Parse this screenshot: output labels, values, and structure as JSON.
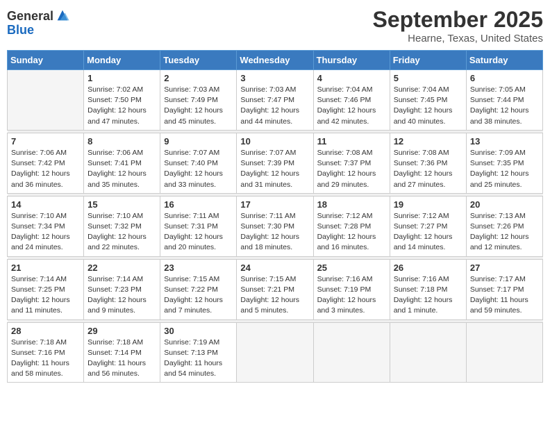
{
  "header": {
    "logo_general": "General",
    "logo_blue": "Blue",
    "month_title": "September 2025",
    "location": "Hearne, Texas, United States"
  },
  "weekdays": [
    "Sunday",
    "Monday",
    "Tuesday",
    "Wednesday",
    "Thursday",
    "Friday",
    "Saturday"
  ],
  "weeks": [
    [
      {
        "day": "",
        "info": ""
      },
      {
        "day": "1",
        "info": "Sunrise: 7:02 AM\nSunset: 7:50 PM\nDaylight: 12 hours\nand 47 minutes."
      },
      {
        "day": "2",
        "info": "Sunrise: 7:03 AM\nSunset: 7:49 PM\nDaylight: 12 hours\nand 45 minutes."
      },
      {
        "day": "3",
        "info": "Sunrise: 7:03 AM\nSunset: 7:47 PM\nDaylight: 12 hours\nand 44 minutes."
      },
      {
        "day": "4",
        "info": "Sunrise: 7:04 AM\nSunset: 7:46 PM\nDaylight: 12 hours\nand 42 minutes."
      },
      {
        "day": "5",
        "info": "Sunrise: 7:04 AM\nSunset: 7:45 PM\nDaylight: 12 hours\nand 40 minutes."
      },
      {
        "day": "6",
        "info": "Sunrise: 7:05 AM\nSunset: 7:44 PM\nDaylight: 12 hours\nand 38 minutes."
      }
    ],
    [
      {
        "day": "7",
        "info": "Sunrise: 7:06 AM\nSunset: 7:42 PM\nDaylight: 12 hours\nand 36 minutes."
      },
      {
        "day": "8",
        "info": "Sunrise: 7:06 AM\nSunset: 7:41 PM\nDaylight: 12 hours\nand 35 minutes."
      },
      {
        "day": "9",
        "info": "Sunrise: 7:07 AM\nSunset: 7:40 PM\nDaylight: 12 hours\nand 33 minutes."
      },
      {
        "day": "10",
        "info": "Sunrise: 7:07 AM\nSunset: 7:39 PM\nDaylight: 12 hours\nand 31 minutes."
      },
      {
        "day": "11",
        "info": "Sunrise: 7:08 AM\nSunset: 7:37 PM\nDaylight: 12 hours\nand 29 minutes."
      },
      {
        "day": "12",
        "info": "Sunrise: 7:08 AM\nSunset: 7:36 PM\nDaylight: 12 hours\nand 27 minutes."
      },
      {
        "day": "13",
        "info": "Sunrise: 7:09 AM\nSunset: 7:35 PM\nDaylight: 12 hours\nand 25 minutes."
      }
    ],
    [
      {
        "day": "14",
        "info": "Sunrise: 7:10 AM\nSunset: 7:34 PM\nDaylight: 12 hours\nand 24 minutes."
      },
      {
        "day": "15",
        "info": "Sunrise: 7:10 AM\nSunset: 7:32 PM\nDaylight: 12 hours\nand 22 minutes."
      },
      {
        "day": "16",
        "info": "Sunrise: 7:11 AM\nSunset: 7:31 PM\nDaylight: 12 hours\nand 20 minutes."
      },
      {
        "day": "17",
        "info": "Sunrise: 7:11 AM\nSunset: 7:30 PM\nDaylight: 12 hours\nand 18 minutes."
      },
      {
        "day": "18",
        "info": "Sunrise: 7:12 AM\nSunset: 7:28 PM\nDaylight: 12 hours\nand 16 minutes."
      },
      {
        "day": "19",
        "info": "Sunrise: 7:12 AM\nSunset: 7:27 PM\nDaylight: 12 hours\nand 14 minutes."
      },
      {
        "day": "20",
        "info": "Sunrise: 7:13 AM\nSunset: 7:26 PM\nDaylight: 12 hours\nand 12 minutes."
      }
    ],
    [
      {
        "day": "21",
        "info": "Sunrise: 7:14 AM\nSunset: 7:25 PM\nDaylight: 12 hours\nand 11 minutes."
      },
      {
        "day": "22",
        "info": "Sunrise: 7:14 AM\nSunset: 7:23 PM\nDaylight: 12 hours\nand 9 minutes."
      },
      {
        "day": "23",
        "info": "Sunrise: 7:15 AM\nSunset: 7:22 PM\nDaylight: 12 hours\nand 7 minutes."
      },
      {
        "day": "24",
        "info": "Sunrise: 7:15 AM\nSunset: 7:21 PM\nDaylight: 12 hours\nand 5 minutes."
      },
      {
        "day": "25",
        "info": "Sunrise: 7:16 AM\nSunset: 7:19 PM\nDaylight: 12 hours\nand 3 minutes."
      },
      {
        "day": "26",
        "info": "Sunrise: 7:16 AM\nSunset: 7:18 PM\nDaylight: 12 hours\nand 1 minute."
      },
      {
        "day": "27",
        "info": "Sunrise: 7:17 AM\nSunset: 7:17 PM\nDaylight: 11 hours\nand 59 minutes."
      }
    ],
    [
      {
        "day": "28",
        "info": "Sunrise: 7:18 AM\nSunset: 7:16 PM\nDaylight: 11 hours\nand 58 minutes."
      },
      {
        "day": "29",
        "info": "Sunrise: 7:18 AM\nSunset: 7:14 PM\nDaylight: 11 hours\nand 56 minutes."
      },
      {
        "day": "30",
        "info": "Sunrise: 7:19 AM\nSunset: 7:13 PM\nDaylight: 11 hours\nand 54 minutes."
      },
      {
        "day": "",
        "info": ""
      },
      {
        "day": "",
        "info": ""
      },
      {
        "day": "",
        "info": ""
      },
      {
        "day": "",
        "info": ""
      }
    ]
  ]
}
